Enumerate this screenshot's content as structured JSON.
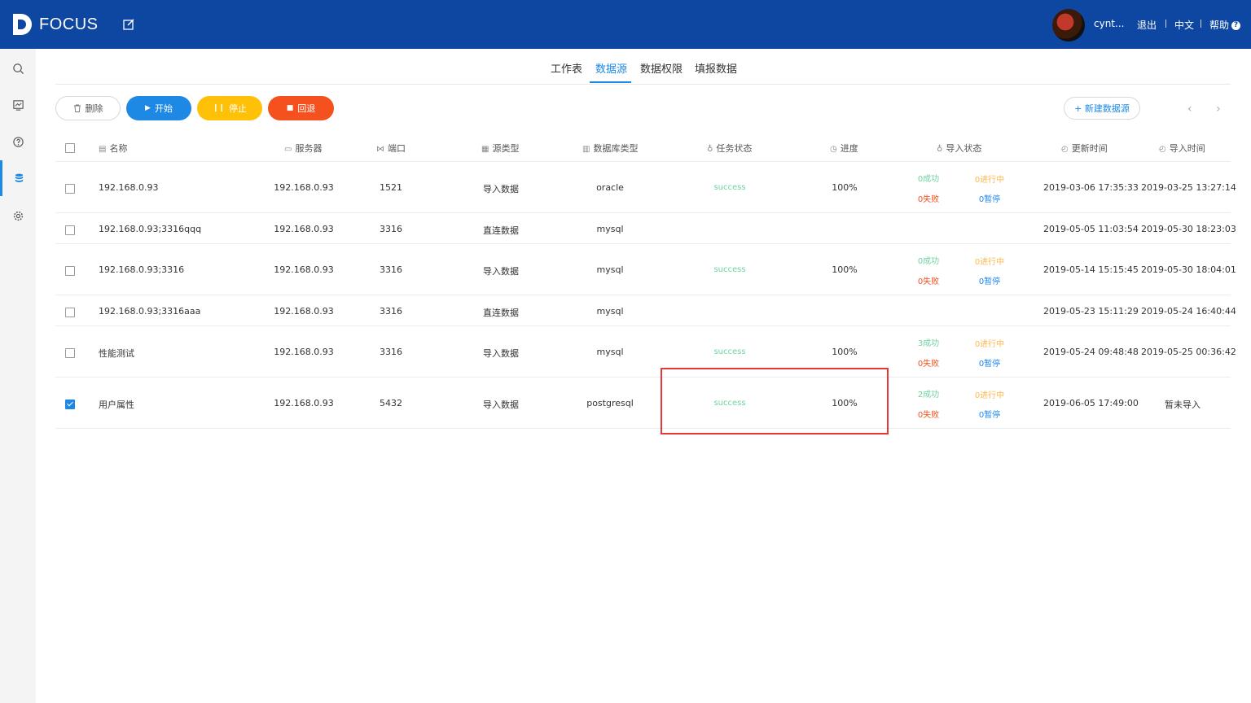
{
  "header": {
    "logo_text": "FOCUS",
    "username": "cynt...",
    "logout": "退出",
    "language": "中文",
    "help": "帮助",
    "help_icon": "?"
  },
  "sidebar": {
    "items": [
      {
        "icon": "search-icon"
      },
      {
        "icon": "dashboard-icon"
      },
      {
        "icon": "help-icon"
      },
      {
        "icon": "datasource-icon",
        "active": true
      },
      {
        "icon": "settings-icon"
      }
    ]
  },
  "tabs": [
    "工作表",
    "数据源",
    "数据权限",
    "填报数据"
  ],
  "active_tab": "数据源",
  "toolbar": {
    "delete": "删除",
    "start": "开始",
    "stop": "停止",
    "rollback": "回退",
    "new_datasource": "+ 新建数据源",
    "prev": "‹",
    "next": "›"
  },
  "colors": {
    "header_bg": "#0d47a1",
    "accent": "#1e88e5",
    "stop": "#ffc107",
    "rollback": "#f4511e",
    "success": "#6fd3a0"
  },
  "table": {
    "headers": {
      "name": "名称",
      "server": "服务器",
      "port": "端口",
      "source_type": "源类型",
      "db_type": "数据库类型",
      "task_status": "任务状态",
      "progress": "进度",
      "import_status": "导入状态",
      "update_time": "更新时间",
      "import_time": "导入时间"
    },
    "rows": [
      {
        "checked": false,
        "name": "192.168.0.93",
        "server": "192.168.0.93",
        "port": "1521",
        "source_type": "导入数据",
        "db_type": "oracle",
        "task_status": "success",
        "progress": "100%",
        "import": {
          "success": "0成功",
          "running": "0进行中",
          "failed": "0失败",
          "paused": "0暂停"
        },
        "update_time": "2019-03-06 17:35:33",
        "import_time": "2019-03-25 13:27:14"
      },
      {
        "checked": false,
        "name": "192.168.0.93;3316qqq",
        "server": "192.168.0.93",
        "port": "3316",
        "source_type": "直连数据",
        "db_type": "mysql",
        "task_status": "",
        "progress": "",
        "import": null,
        "update_time": "2019-05-05 11:03:54",
        "import_time": "2019-05-30 18:23:03"
      },
      {
        "checked": false,
        "name": "192.168.0.93;3316",
        "server": "192.168.0.93",
        "port": "3316",
        "source_type": "导入数据",
        "db_type": "mysql",
        "task_status": "success",
        "progress": "100%",
        "import": {
          "success": "0成功",
          "running": "0进行中",
          "failed": "0失败",
          "paused": "0暂停"
        },
        "update_time": "2019-05-14 15:15:45",
        "import_time": "2019-05-30 18:04:01"
      },
      {
        "checked": false,
        "name": "192.168.0.93;3316aaa",
        "server": "192.168.0.93",
        "port": "3316",
        "source_type": "直连数据",
        "db_type": "mysql",
        "task_status": "",
        "progress": "",
        "import": null,
        "update_time": "2019-05-23 15:11:29",
        "import_time": "2019-05-24 16:40:44"
      },
      {
        "checked": false,
        "name": "性能测试",
        "server": "192.168.0.93",
        "port": "3316",
        "source_type": "导入数据",
        "db_type": "mysql",
        "task_status": "success",
        "progress": "100%",
        "import": {
          "success": "3成功",
          "running": "0进行中",
          "failed": "0失败",
          "paused": "0暂停"
        },
        "update_time": "2019-05-24 09:48:48",
        "import_time": "2019-05-25 00:36:42"
      },
      {
        "checked": true,
        "name": "用户属性",
        "server": "192.168.0.93",
        "port": "5432",
        "source_type": "导入数据",
        "db_type": "postgresql",
        "task_status": "success",
        "progress": "100%",
        "import": {
          "success": "2成功",
          "running": "0进行中",
          "failed": "0失败",
          "paused": "0暂停"
        },
        "update_time": "2019-06-05 17:49:00",
        "import_time": "暂未导入"
      }
    ]
  }
}
